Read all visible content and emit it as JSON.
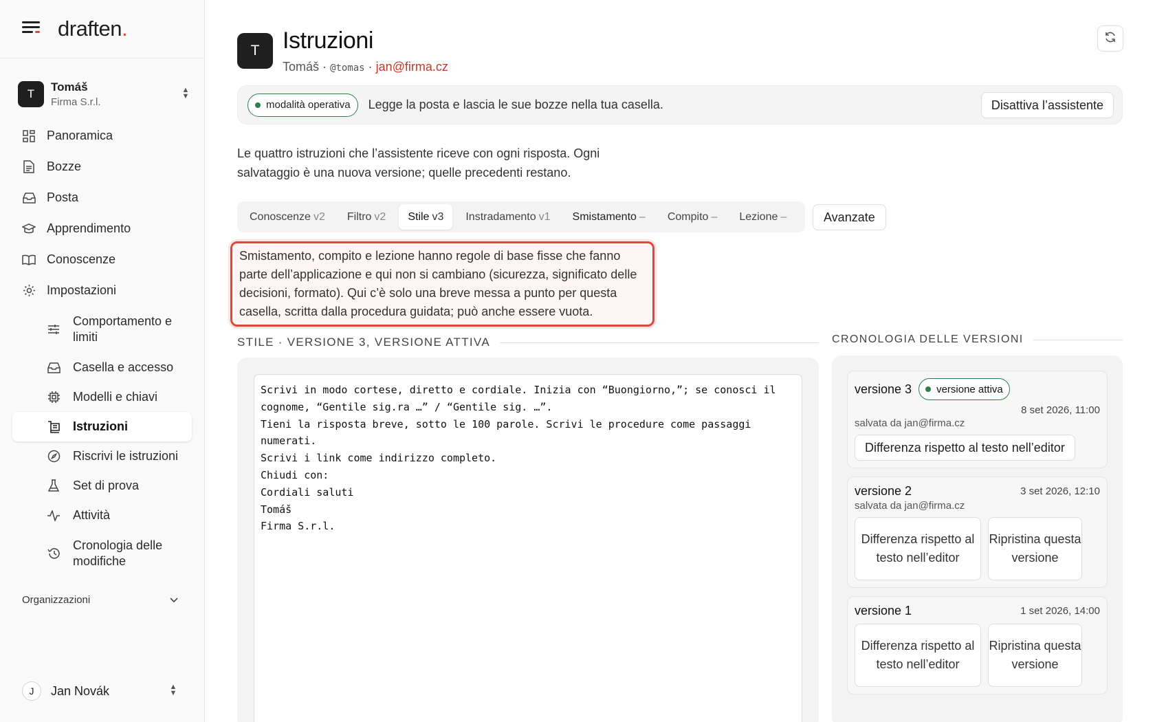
{
  "brand": {
    "name": "draften",
    "dot": "."
  },
  "workspace": {
    "initial": "T",
    "name": "Tomáš",
    "org": "Firma S.r.l."
  },
  "nav": {
    "items": [
      {
        "label": "Panoramica",
        "icon": "dashboard-icon"
      },
      {
        "label": "Bozze",
        "icon": "document-icon"
      },
      {
        "label": "Posta",
        "icon": "inbox-icon"
      },
      {
        "label": "Apprendimento",
        "icon": "graduation-cap-icon"
      },
      {
        "label": "Conoscenze",
        "icon": "book-icon"
      },
      {
        "label": "Impostazioni",
        "icon": "gear-icon"
      }
    ],
    "sub": [
      {
        "label": "Comportamento e limiti",
        "icon": "sliders-icon"
      },
      {
        "label": "Casella e accesso",
        "icon": "inbox-icon"
      },
      {
        "label": "Modelli e chiavi",
        "icon": "chip-icon"
      },
      {
        "label": "Istruzioni",
        "icon": "instructions-icon"
      },
      {
        "label": "Riscrivi le istruzioni",
        "icon": "compass-icon"
      },
      {
        "label": "Set di prova",
        "icon": "flask-icon"
      },
      {
        "label": "Attività",
        "icon": "activity-icon"
      },
      {
        "label": "Cronologia delle modifiche",
        "icon": "history-icon"
      }
    ],
    "orgs_label": "Organizzazioni"
  },
  "user": {
    "initial": "J",
    "name": "Jan Novák"
  },
  "header": {
    "initial": "T",
    "title": "Istruzioni",
    "name": "Tomáš",
    "sep": " · ",
    "handle": "@tomas",
    "email": "jan@firma.cz"
  },
  "banner": {
    "pill": "modalità operativa",
    "text": "Legge la posta e lascia le sue bozze nella tua casella.",
    "button": "Disattiva l’assistente"
  },
  "intro": "Le quattro istruzioni che l’assistente riceve con ogni risposta. Ogni salvataggio è una nuova versione; quelle precedenti restano.",
  "tabs": [
    {
      "label": "Conoscenze",
      "version": "v2"
    },
    {
      "label": "Filtro",
      "version": "v2"
    },
    {
      "label": "Stile",
      "version": "v3"
    },
    {
      "label": "Instradamento",
      "version": "v1"
    },
    {
      "label": "Smistamento",
      "version": "–"
    },
    {
      "label": "Compito",
      "version": "–"
    },
    {
      "label": "Lezione",
      "version": "–"
    }
  ],
  "advanced_button": "Avanzate",
  "note": "Smistamento, compito e lezione hanno regole di base fisse che fanno parte dell’applicazione e qui non si cambiano (sicurezza, significato delle decisioni, formato). Qui c’è solo una breve messa a punto per questa casella, scritta dalla procedura guidata; può anche essere vuota.",
  "section_title": "STILE · VERSIONE 3, VERSIONE ATTIVA",
  "editor_text": "Scrivi in modo cortese, diretto e cordiale. Inizia con “Buongiorno,”; se conosci il cognome, “Gentile sig.ra …” / “Gentile sig. …”.\nTieni la risposta breve, sotto le 100 parole. Scrivi le procedure come passaggi numerati.\nScrivi i link come indirizzo completo.\nChiudi con:\nCordiali saluti\nTomáš\nFirma S.r.l.",
  "history": {
    "title": "CRONOLOGIA DELLE VERSIONI",
    "versions": [
      {
        "label": "versione 3",
        "badge": "versione attiva",
        "date": "8 set 2026, 11:00",
        "by": "salvata da jan@firma.cz",
        "diff": "Differenza rispetto al testo nell’editor"
      },
      {
        "label": "versione 2",
        "date": "3 set 2026, 12:10",
        "by": "salvata da jan@firma.cz",
        "diff": "Differenza rispetto al testo nell’editor",
        "restore": "Ripristina questa versione"
      },
      {
        "label": "versione 1",
        "date": "1 set 2026, 14:00",
        "diff": "Differenza rispetto al testo nell’editor",
        "restore": "Ripristina questa versione"
      }
    ]
  },
  "colors": {
    "accent": "#d94a3d",
    "active_green": "#2e7d4f",
    "dark": "#1f1f1f"
  }
}
